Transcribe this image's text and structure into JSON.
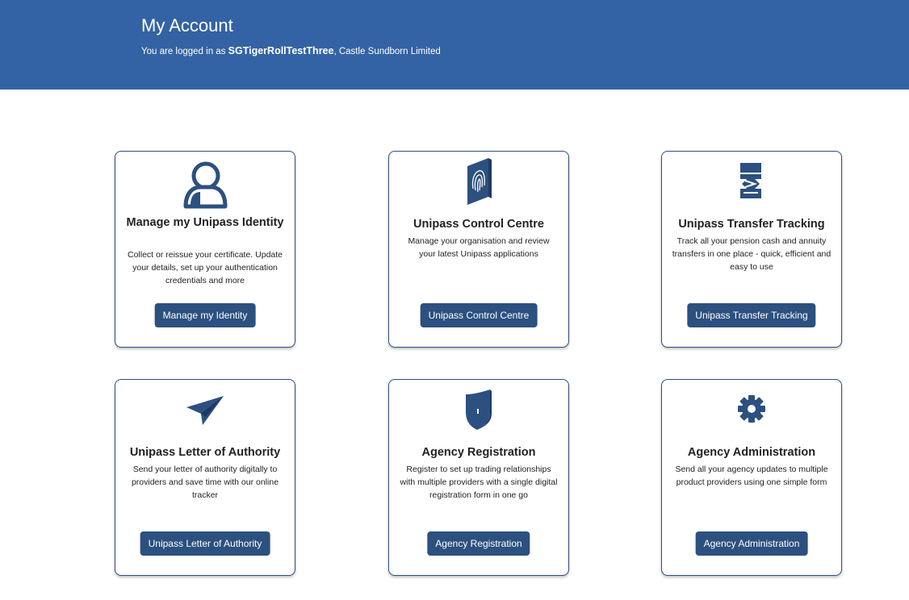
{
  "header": {
    "title": "My Account",
    "logged_in_prefix": "You are logged in as ",
    "username": "SGTigerRollTestThree",
    "org_suffix": ", Castle Sundborn Limited"
  },
  "cards": [
    {
      "icon": "user-icon",
      "title": "Manage my Unipass Identity",
      "description": "Collect or reissue your certificate. Update your details, set up your authentication credentials and more",
      "button": "Manage my Identity"
    },
    {
      "icon": "fingerprint-book-icon",
      "title": "Unipass Control Centre",
      "description": "Manage your organisation and review your latest Unipass applications",
      "button": "Unipass Control Centre"
    },
    {
      "icon": "document-transfer-icon",
      "title": "Unipass Transfer Tracking",
      "description": "Track all your pension cash and annuity transfers in one place - quick, efficient and easy to use",
      "button": "Unipass Transfer Tracking"
    },
    {
      "icon": "paper-plane-icon",
      "title": "Unipass Letter of Authority",
      "description": "Send your letter of authority digitally to providers and save time with our online tracker",
      "button": "Unipass Letter of Authority"
    },
    {
      "icon": "shield-icon",
      "title": "Agency Registration",
      "description": "Register to set up trading relationships with multiple providers with a single digital registration form in one go",
      "button": "Agency Registration"
    },
    {
      "icon": "gear-icon",
      "title": "Agency Administration",
      "description": "Send all your agency updates to multiple product providers using one simple form",
      "button": "Agency Administration"
    }
  ],
  "colors": {
    "header_bg": "#3363a4",
    "button_bg": "#2c507f",
    "icon_color": "#2c507f"
  }
}
